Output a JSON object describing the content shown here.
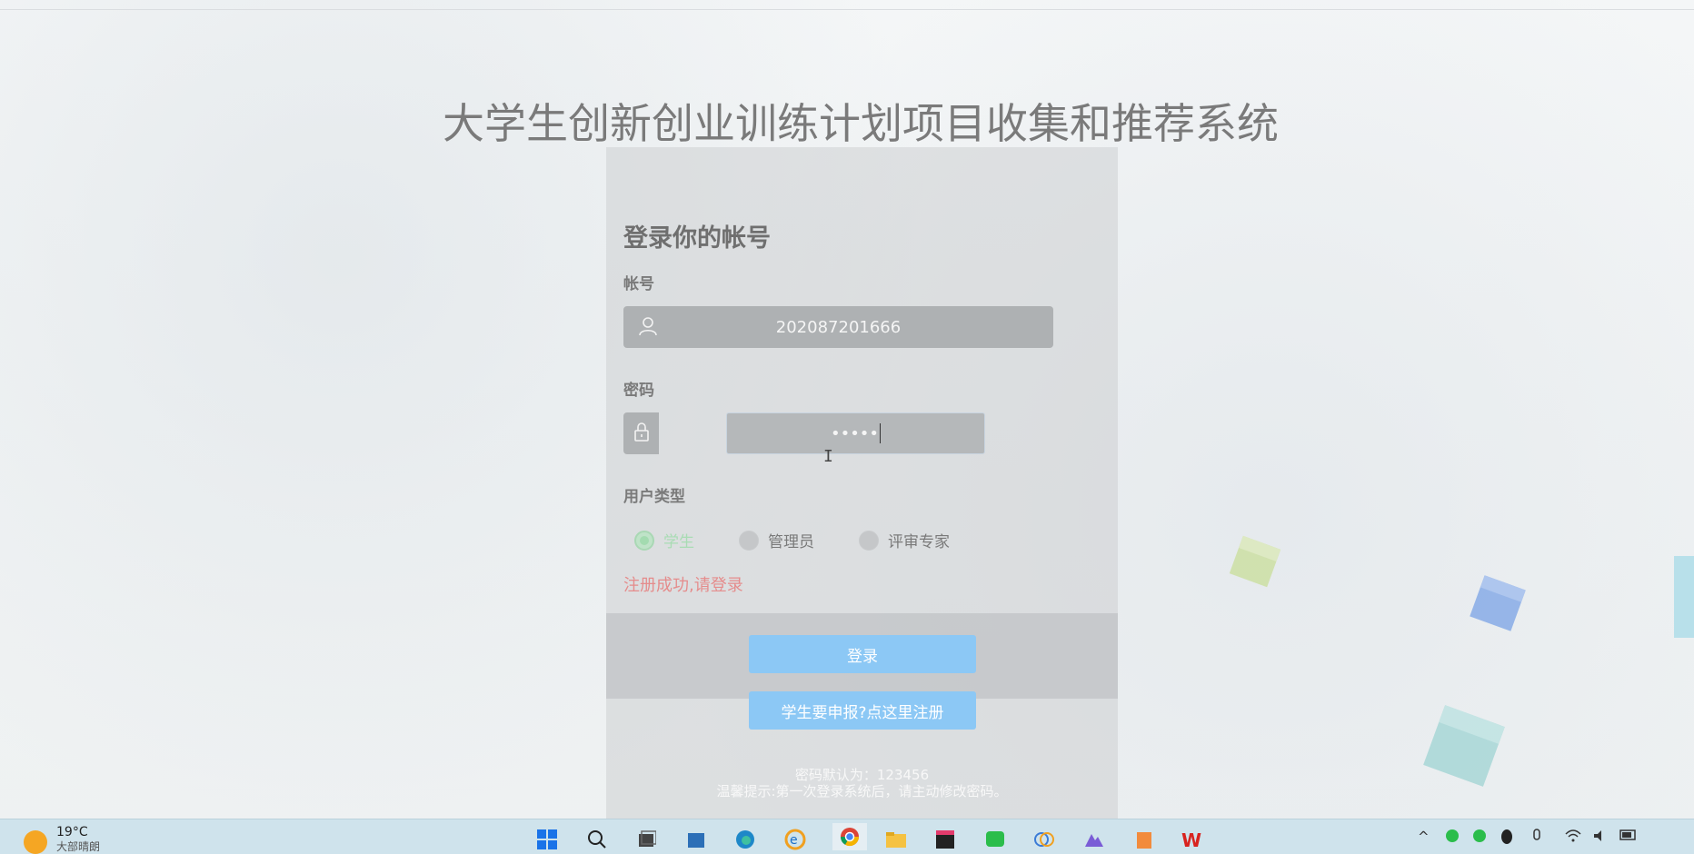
{
  "page": {
    "title": "大学生创新创业训练计划项目收集和推荐系统"
  },
  "login": {
    "heading": "登录你的帐号",
    "account_label": "帐号",
    "account_value": "202087201666",
    "password_label": "密码",
    "password_value": "•••••",
    "user_type_label": "用户类型",
    "user_types": [
      {
        "label": "学生",
        "checked": true
      },
      {
        "label": "管理员",
        "checked": false
      },
      {
        "label": "评审专家",
        "checked": false
      }
    ],
    "success_message": "注册成功,请登录",
    "login_button": "登录",
    "register_button": "学生要申报?点这里注册",
    "hint_line1": "密码默认为：123456",
    "hint_line2": "温馨提示:第一次登录系统后，请主动修改密码。",
    "colors": {
      "button": "#8cc8f5",
      "success": "#e58c8c",
      "checked_radio": "#a3dbb0"
    }
  },
  "taskbar": {
    "weather_temp": "19°C",
    "weather_desc": "大部晴朗",
    "icons": [
      "windows-icon",
      "search-icon",
      "task-view-icon",
      "app-icon",
      "edge-icon",
      "ie-icon",
      "chrome-icon",
      "folder-icon",
      "jetbrains-icon",
      "wechat-icon",
      "app-icon-2",
      "app-icon-3",
      "app-icon-4",
      "wps-icon"
    ]
  }
}
